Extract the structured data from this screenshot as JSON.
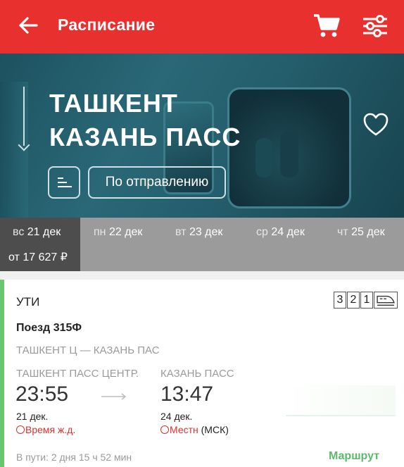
{
  "header": {
    "title": "Расписание",
    "background_color": "#e8302e"
  },
  "hero": {
    "from": "ТАШКЕНТ",
    "to": "КАЗАНЬ ПАСС",
    "sort_label": "По отправлению"
  },
  "days": [
    {
      "weekday": "вс",
      "date": "21 дек",
      "price": "от 17 627 ₽",
      "active": true
    },
    {
      "weekday": "пн",
      "date": "22 дек"
    },
    {
      "weekday": "вт",
      "date": "23 дек"
    },
    {
      "weekday": "ср",
      "date": "24 дек"
    },
    {
      "weekday": "чт",
      "date": "25 дек"
    }
  ],
  "train": {
    "operator": "УТИ",
    "classes": [
      "3",
      "2",
      "1"
    ],
    "number": "Поезд 315Ф",
    "route": "ТАШКЕНТ Ц — КАЗАНЬ ПАС",
    "departure": {
      "station": "ТАШКЕНТ ПАСС ЦЕНТР.",
      "time": "23:55",
      "date": "21 дек.",
      "zone": "Время ж.д."
    },
    "arrival": {
      "station": "КАЗАНЬ ПАСС",
      "time": "13:47",
      "date": "24 дек.",
      "zone_local": "Местн",
      "zone_msk": " (МСК)"
    },
    "duration": "В пути: 2 дня 15 ч 52 мин",
    "route_link": "Маршрут",
    "accent_color": "#6ac771"
  }
}
